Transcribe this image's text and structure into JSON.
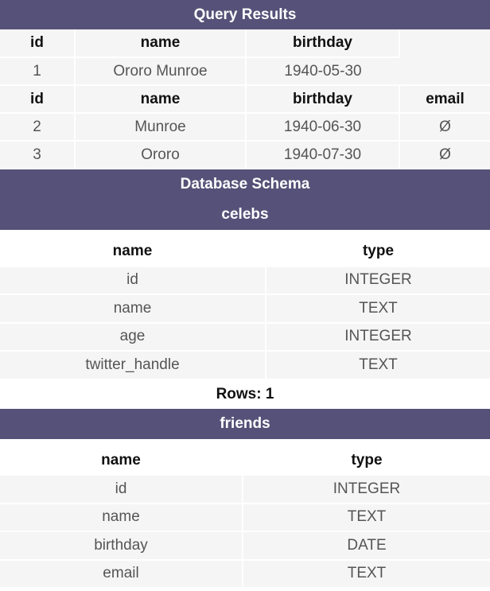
{
  "query_results": {
    "title": "Query Results",
    "set1": {
      "headers": [
        "id",
        "name",
        "birthday",
        ""
      ],
      "rows": [
        [
          "1",
          "Ororo Munroe",
          "1940-05-30",
          ""
        ]
      ]
    },
    "set2": {
      "headers": [
        "id",
        "name",
        "birthday",
        "email"
      ],
      "rows": [
        [
          "2",
          "Munroe",
          "1940-06-30",
          "Ø"
        ],
        [
          "3",
          "Ororo",
          "1940-07-30",
          "Ø"
        ]
      ]
    }
  },
  "schema": {
    "title": "Database Schema",
    "tables": [
      {
        "name": "celebs",
        "headers": [
          "name",
          "type"
        ],
        "columns": [
          [
            "id",
            "INTEGER"
          ],
          [
            "name",
            "TEXT"
          ],
          [
            "age",
            "INTEGER"
          ],
          [
            "twitter_handle",
            "TEXT"
          ]
        ],
        "rows_label": "Rows: 1"
      },
      {
        "name": "friends",
        "headers": [
          "name",
          "type"
        ],
        "columns": [
          [
            "id",
            "INTEGER"
          ],
          [
            "name",
            "TEXT"
          ],
          [
            "birthday",
            "DATE"
          ],
          [
            "email",
            "TEXT"
          ]
        ]
      }
    ]
  }
}
